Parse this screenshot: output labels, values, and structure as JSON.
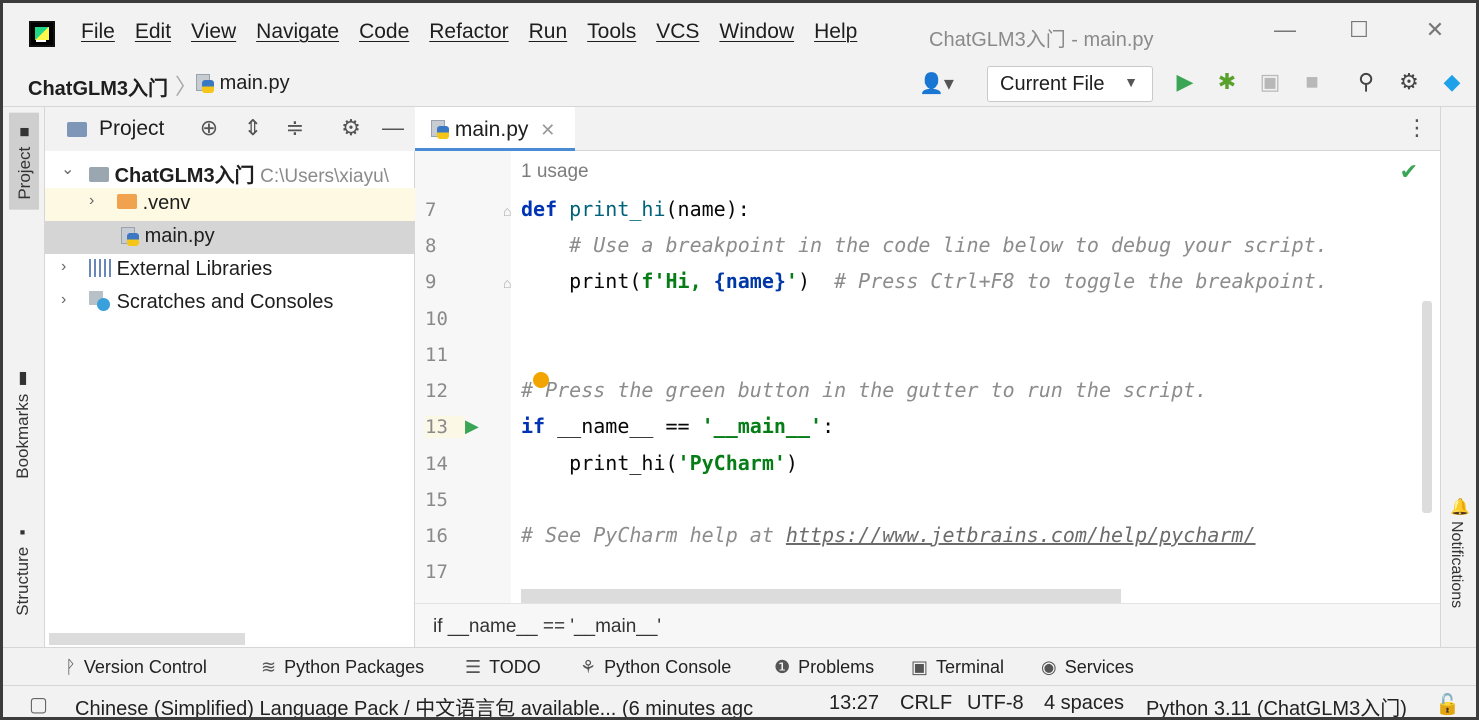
{
  "app": {
    "menu": [
      "File",
      "Edit",
      "View",
      "Navigate",
      "Code",
      "Refactor",
      "Run",
      "Tools",
      "VCS",
      "Window",
      "Help"
    ],
    "window_title": "ChatGLM3入门 - main.py",
    "min_glyph": "—",
    "max_glyph": "☐",
    "close_glyph": "✕"
  },
  "navbar": {
    "project_crumb": "ChatGLM3入门",
    "file_crumb": "main.py",
    "run_config": "Current File"
  },
  "left_strip": {
    "project": "Project",
    "bookmarks": "Bookmarks",
    "structure": "Structure"
  },
  "project_panel": {
    "title": "Project",
    "tree": [
      {
        "label": "ChatGLM3入门",
        "path": "C:\\Users\\xiayu\\"
      },
      {
        "label": ".venv"
      },
      {
        "label": "main.py"
      },
      {
        "label": "External Libraries"
      },
      {
        "label": "Scratches and Consoles"
      }
    ]
  },
  "editor": {
    "tab_label": "main.py",
    "usage": "1 usage",
    "line_numbers": [
      "7",
      "8",
      "9",
      "10",
      "11",
      "12",
      "13",
      "14",
      "15",
      "16",
      "17"
    ],
    "lines": {
      "l7_kw": "def",
      "l7_fn": " print_hi",
      "l7_rest": "(name):",
      "l8_cm": "    # Use a breakpoint in the code line below to debug your script.",
      "l9_a": "    print(",
      "l9_str1": "f'Hi, ",
      "l9_name": "{name}",
      "l9_str2": "'",
      "l9_b": ")  ",
      "l9_cm": "# Press Ctrl+F8 to toggle the breakpoint.",
      "l12_cm": "# Press the green button in the gutter to run the script.",
      "l13_kw": "if",
      "l13_a": " __name__ == ",
      "l13_str": "'__main__'",
      "l13_b": ":",
      "l14_a": "    print_hi(",
      "l14_str": "'PyCharm'",
      "l14_b": ")",
      "l16_cm": "# See PyCharm help at ",
      "l16_link": "https://www.jetbrains.com/help/pycharm/"
    },
    "breadcrumb": "if __name__ == '__main__'"
  },
  "right_strip": {
    "notifications": "Notifications"
  },
  "tool_windows": [
    "Version Control",
    "Python Packages",
    "TODO",
    "Python Console",
    "Problems",
    "Terminal",
    "Services"
  ],
  "status": {
    "message": "Chinese (Simplified) Language Pack / 中文语言包 available... (6 minutes agc",
    "position": "13:27",
    "line_sep": "CRLF",
    "encoding": "UTF-8",
    "indent": "4 spaces",
    "interpreter": "Python 3.11 (ChatGLM3入门)"
  },
  "colors": {
    "run_green": "#3aa655",
    "debug_green": "#5aa02c",
    "keyword": "#0033b3",
    "string": "#067d17",
    "comment": "#8c8c8c"
  }
}
